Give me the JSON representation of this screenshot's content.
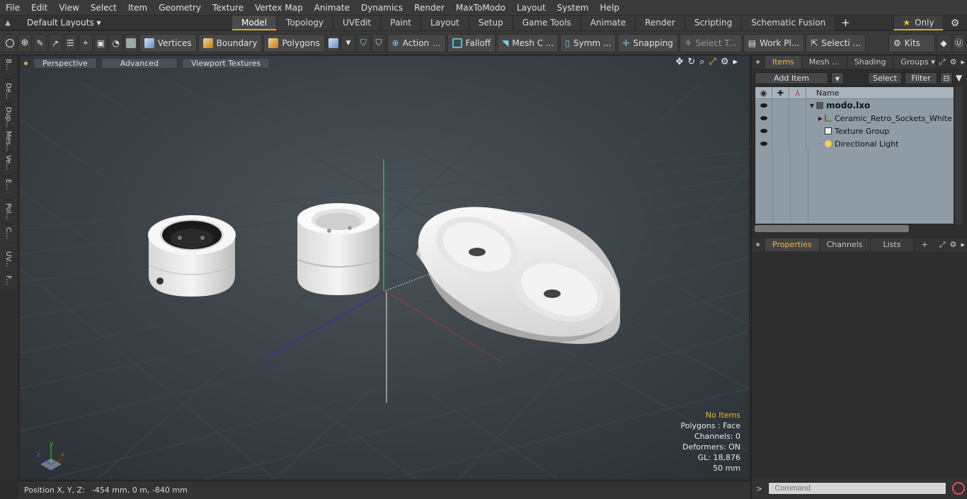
{
  "menu": [
    "File",
    "Edit",
    "View",
    "Select",
    "Item",
    "Geometry",
    "Texture",
    "Vertex Map",
    "Animate",
    "Dynamics",
    "Render",
    "MaxToModo",
    "Layout",
    "System",
    "Help"
  ],
  "layout": {
    "layouts_label": "Default Layouts ▾",
    "tabs": [
      {
        "label": "Model",
        "active": true
      },
      {
        "label": "Topology"
      },
      {
        "label": "UVEdit"
      },
      {
        "label": "Paint"
      },
      {
        "label": "Layout"
      },
      {
        "label": "Setup"
      },
      {
        "label": "Game Tools"
      },
      {
        "label": "Animate"
      },
      {
        "label": "Render"
      },
      {
        "label": "Scripting"
      },
      {
        "label": "Schematic Fusion"
      }
    ],
    "plus": "+",
    "only_label": "Only",
    "star": "★",
    "gear": "⚙"
  },
  "toolbar": {
    "vertices": "Vertices",
    "boundary": "Boundary",
    "polygons": "Polygons",
    "action": "Action",
    "falloff": "Falloff",
    "mesh": "Mesh C ...",
    "symm": "Symm ...",
    "snapping": "Snapping",
    "select_t": "Select T...",
    "work_pl": "Work Pl...",
    "selecti": "Selecti ...",
    "kits": "Kits",
    "dots": "..."
  },
  "left_tabs": [
    "B...",
    "De...",
    "Dup...",
    "Mes...",
    "Ve...",
    "E...",
    "Pol...",
    "C...",
    "UV...",
    "F..."
  ],
  "viewport": {
    "perspective": "Perspective",
    "advanced": "Advanced",
    "viewport_textures": "Viewport Textures",
    "info": {
      "no_items": "No Items",
      "polygons": "Polygons : Face",
      "channels": "Channels: 0",
      "deformers": "Deformers: ON",
      "gl": "GL: 18,876",
      "scale": "50 mm"
    },
    "axis_x": "x",
    "axis_y": "y",
    "axis_z": "z"
  },
  "status": {
    "position_label": "Position X, Y, Z:",
    "position_value": "-454 mm, 0 m, -840 mm"
  },
  "items_panel": {
    "tabs": [
      "Items",
      "Mesh ...",
      "Shading",
      "Groups"
    ],
    "add_item": "Add Item",
    "select": "Select",
    "filter": "Filter",
    "name_header": "Name",
    "rows": [
      {
        "label": "modo.lxo"
      },
      {
        "label": "Ceramic_Retro_Sockets_White"
      },
      {
        "label": "Texture Group"
      },
      {
        "label": "Directional Light"
      }
    ]
  },
  "properties_panel": {
    "tabs": [
      "Properties",
      "Channels",
      "Lists"
    ],
    "plus": "+"
  },
  "command": {
    "prompt": ">",
    "placeholder": "Command"
  },
  "colors": {
    "accent": "#e9a23b",
    "viewport_bg": "#3a4247",
    "item_list_bg": "#8f9ca6"
  }
}
